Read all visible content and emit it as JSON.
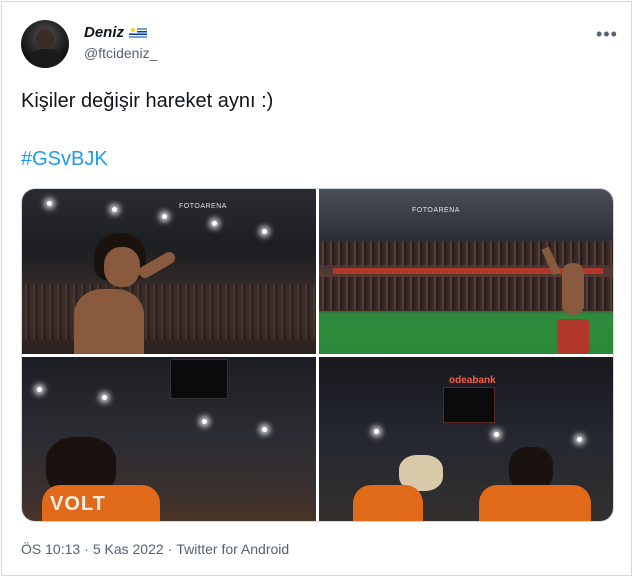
{
  "tweet": {
    "display_name": "Deniz",
    "handle": "@ftcideniz_",
    "text": "Kişiler değişir hareket aynı :)",
    "hashtag": "#GSvBJK",
    "more_label": "•••",
    "flag_icon": "uruguay-flag-icon",
    "time": "ÖS 10:13",
    "separator": "·",
    "date": "5 Kas 2022",
    "source": "Twitter for Android"
  },
  "media": {
    "photos": [
      {
        "watermark": "FOTOARENA"
      },
      {
        "watermark": "FOTOARENA"
      },
      {
        "watermark": ""
      },
      {
        "watermark": ""
      }
    ],
    "photo3_overlay_text": "VOLT",
    "photo4_sponsor_text": "odeabank"
  },
  "colors": {
    "link": "#1d9bf0",
    "secondary_text": "#536471",
    "primary_text": "#0f1419",
    "border": "#cfd9de"
  }
}
